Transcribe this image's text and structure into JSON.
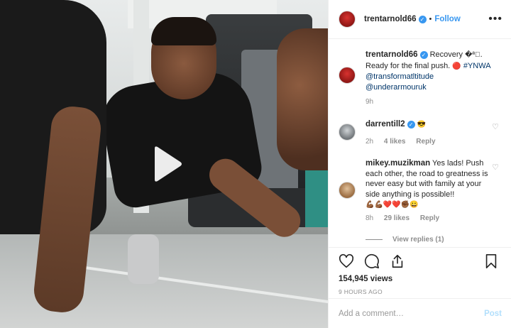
{
  "header": {
    "username": "trentarnold66",
    "separator": "•",
    "follow_label": "Follow",
    "more_label": "•••"
  },
  "caption": {
    "username": "trentarnold66",
    "text_1": "Recovery",
    "emoji_1": "�ª🏾",
    "text_2": ". Ready for the final push.",
    "emoji_2": "🔴",
    "hashtag": "#YNWA",
    "mention_1": "@transformatltitude",
    "mention_2": "@underarmouruk",
    "time": "9h"
  },
  "comments": [
    {
      "username": "darrentill2",
      "text": "😎",
      "time": "2h",
      "likes": "4 likes",
      "reply_label": "Reply"
    },
    {
      "username": "mikey.muzikman",
      "text": "Yes lads! Push each other, the road to greatness is never easy but with family at your side anything is possible!!",
      "emojis": "💪🏾💪🏾❤️❤️✊🏾😀",
      "time": "8h",
      "likes": "29 likes",
      "reply_label": "Reply"
    }
  ],
  "view_replies_label": "View replies (1)",
  "stats": {
    "views": "154,945 views",
    "ago": "9 HOURS AGO"
  },
  "add_comment": {
    "placeholder": "Add a comment…",
    "post_label": "Post"
  },
  "colors": {
    "accent": "#3897f0",
    "post_disabled": "#b2dffc",
    "muted": "#8e8e8e",
    "link": "#003569"
  },
  "icons": [
    "play-icon",
    "verified-icon",
    "heart-icon",
    "comment-icon",
    "share-icon",
    "bookmark-icon",
    "more-icon"
  ]
}
